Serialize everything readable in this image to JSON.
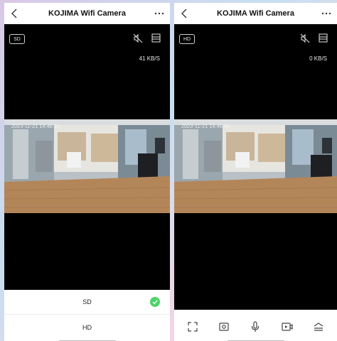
{
  "left": {
    "title": "KOJIMA Wifi Camera",
    "quality_badge": "SD",
    "speed": "41 KB/S",
    "timestamp": "2023-11-21 14:46:11",
    "quality_options": [
      {
        "label": "SD",
        "selected": true
      },
      {
        "label": "HD",
        "selected": false
      }
    ]
  },
  "right": {
    "title": "KOJIMA Wifi Camera",
    "quality_badge": "HD",
    "speed": "0 KB/S",
    "timestamp": "2023-11-21 14:46:56"
  },
  "icons": {
    "back": "chevron-left-icon",
    "more": "ellipsis-icon",
    "mute": "speaker-muted-icon",
    "layout": "layout-icon",
    "check": "check-circle-icon",
    "controls": [
      "fullscreen-icon",
      "screenshot-icon",
      "microphone-icon",
      "record-icon",
      "menu-icon"
    ]
  },
  "colors": {
    "viewer_bg": "#000000",
    "check": "#4cd26b",
    "text_light": "#e6e6e6"
  }
}
